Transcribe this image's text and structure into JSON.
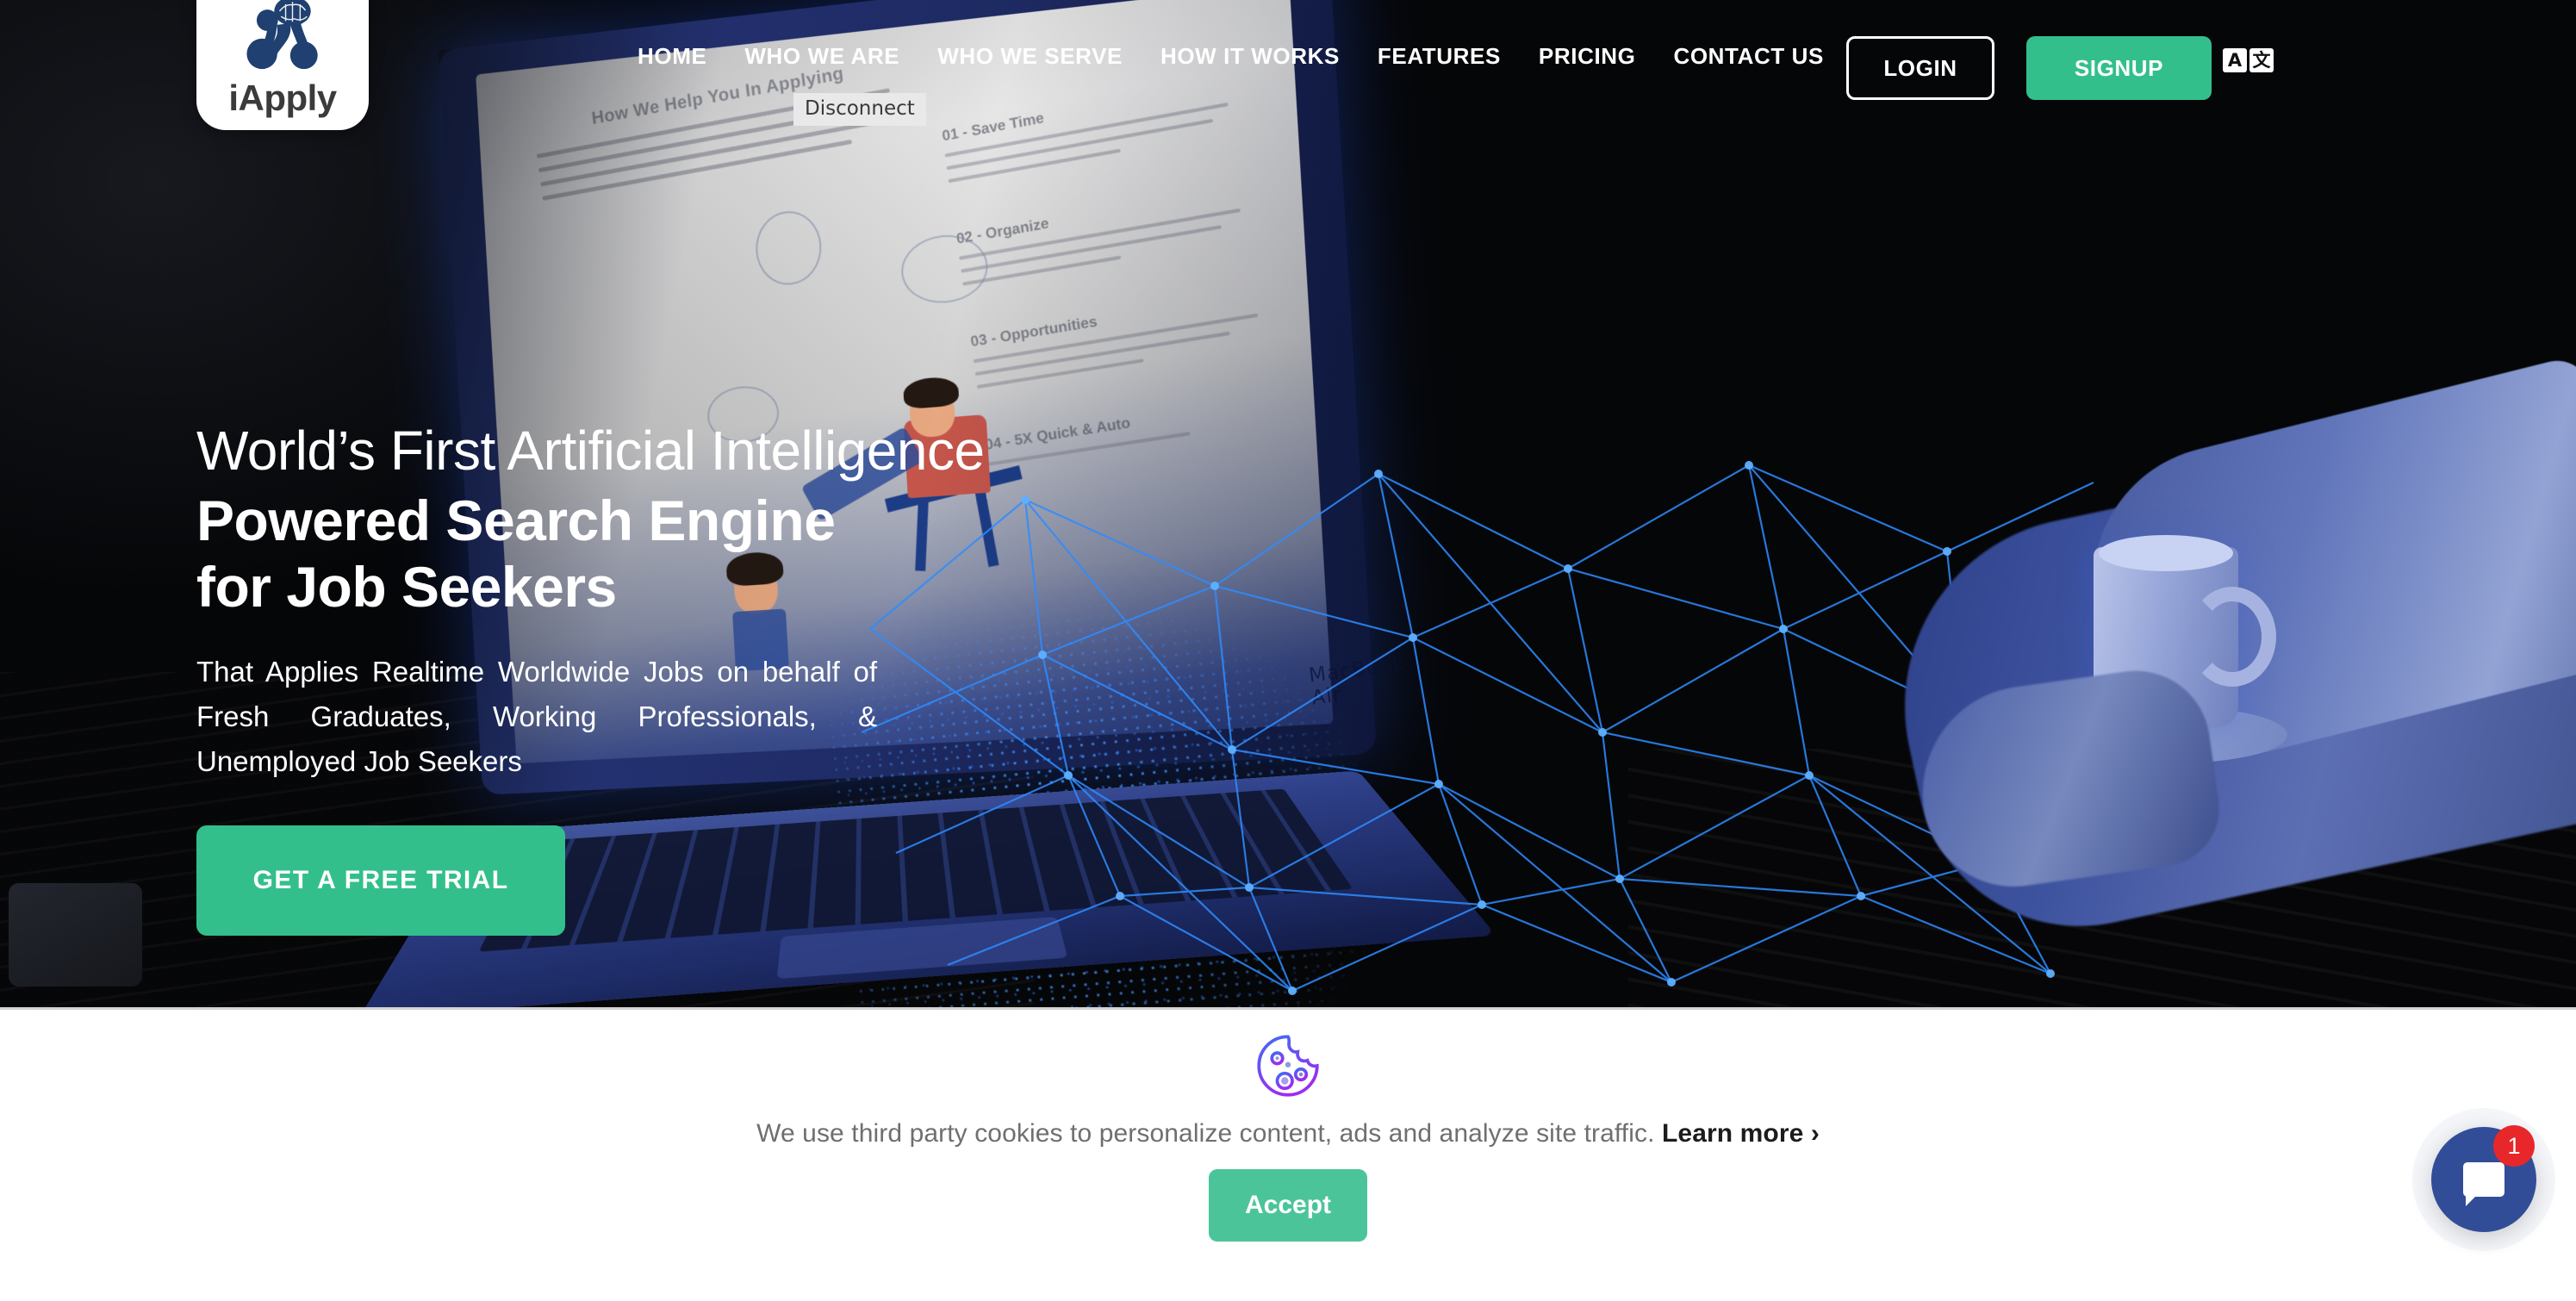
{
  "brand": {
    "name": "iApply",
    "logo_icon": "brain-network-icon",
    "logo_color": "#1f4070"
  },
  "header": {
    "nav": [
      {
        "label": "HOME"
      },
      {
        "label": "WHO WE ARE"
      },
      {
        "label": "WHO WE SERVE"
      },
      {
        "label": "HOW IT WORKS"
      },
      {
        "label": "FEATURES"
      },
      {
        "label": "PRICING"
      },
      {
        "label": "CONTACT US"
      }
    ],
    "login_label": "LOGIN",
    "signup_label": "SIGNUP",
    "signup_color": "#33bf8c",
    "translate_icon": "translate-icon",
    "translate_glyph_left": "A",
    "translate_glyph_right": "文"
  },
  "tooltip": {
    "label": "Disconnect"
  },
  "hero": {
    "headline_line1": "World’s First Artificial Intelligence",
    "headline_line2": "Powered Search Engine",
    "headline_line3": "for Job Seekers",
    "subtext": "That Applies Realtime Worldwide Jobs on behalf of Fresh Graduates, Working Professionals, & Unemployed Job Seekers",
    "cta_label": "GET A FREE TRIAL",
    "cta_color": "#33bf8c",
    "laptop_label": "MacBook Air",
    "screen": {
      "title": "How We Help You In Applying",
      "sections": [
        {
          "heading": "01 - Save Time"
        },
        {
          "heading": "02 - Organize"
        },
        {
          "heading": "03 - Opportunities"
        },
        {
          "heading": "04 - 5X Quick & Auto"
        }
      ]
    }
  },
  "cookie_banner": {
    "icon": "cookie-icon",
    "message": "We use third party cookies to personalize content, ads and analyze site traffic.",
    "learn_more_label": "Learn more",
    "learn_more_chevron": "›",
    "accept_label": "Accept",
    "accept_color": "#4cc49a"
  },
  "chat_widget": {
    "icon": "chat-bubble-icon",
    "badge_count": "1",
    "bubble_color": "#324d97",
    "badge_color": "#e8272a"
  }
}
